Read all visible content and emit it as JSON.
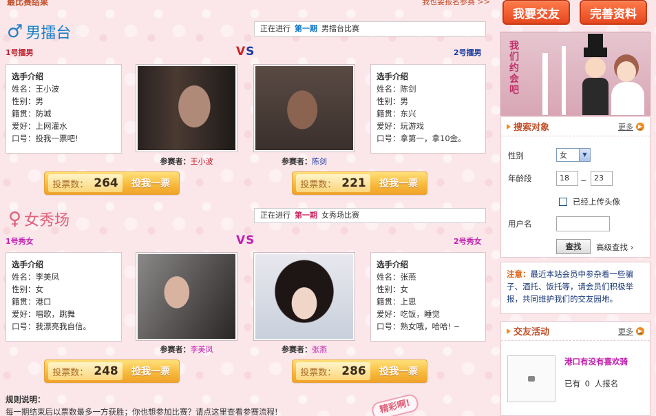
{
  "top": {
    "left_text": "最比赛结果",
    "right_text": "我也要报名参赛 >>"
  },
  "male_section": {
    "symbol": "♂",
    "title": "男擂台",
    "status": {
      "prefix": "正在进行",
      "period": "第一期",
      "suffix": "男擂台比赛"
    },
    "left_slot": "1号擂男",
    "right_slot": "2号擂男",
    "vs": "VS",
    "left": {
      "intro_title": "选手介绍",
      "fields": [
        "姓名：王小波",
        "性别：男",
        "籍贯：防城",
        "爱好：上网灌水",
        "口号：投我一票吧!"
      ],
      "caption_label": "参赛者：",
      "caption_name": "王小波",
      "vote_label": "投票数：",
      "votes": "264",
      "vote_button": "投我一票"
    },
    "right": {
      "intro_title": "选手介绍",
      "fields": [
        "姓名：陈剑",
        "性别：男",
        "籍贯：东兴",
        "爱好：玩游戏",
        "口号：拿第一，拿10金。"
      ],
      "caption_label": "参赛者：",
      "caption_name": "陈剑",
      "vote_label": "投票数：",
      "votes": "221",
      "vote_button": "投我一票"
    }
  },
  "female_section": {
    "symbol": "♀",
    "title": "女秀场",
    "status": {
      "prefix": "正在进行",
      "period": "第一期",
      "suffix": "女秀场比赛"
    },
    "left_slot": "1号秀女",
    "right_slot": "2号秀女",
    "vs": "VS",
    "left": {
      "intro_title": "选手介绍",
      "fields": [
        "姓名：李美凤",
        "性别：女",
        "籍贯：港口",
        "爱好：唱歌，跳舞",
        "口号：我漂亮我自信。"
      ],
      "caption_label": "参赛者：",
      "caption_name": "李美凤",
      "vote_label": "投票数：",
      "votes": "248",
      "vote_button": "投我一票"
    },
    "right": {
      "intro_title": "选手介绍",
      "fields": [
        "姓名：张燕",
        "性别：女",
        "籍贯：上思",
        "爱好：吃饭，睡觉",
        "口号：熟女哦，哈哈! ~"
      ],
      "caption_label": "参赛者：",
      "caption_name": "张燕",
      "vote_label": "投票数：",
      "votes": "286",
      "vote_button": "投我一票"
    }
  },
  "rules": {
    "title": "规则说明：",
    "text": "每一期结束后以票数最多一方获胜；你也想参加比赛？请点这里查看参赛流程!"
  },
  "stamp_text": "精彩啊!",
  "sidebar": {
    "btn_friends": "我要交友",
    "btn_profile": "完善资料",
    "banner_text": "我们约会吧",
    "search": {
      "title": "搜索对象",
      "more": "更多",
      "gender_label": "性别",
      "gender_value": "女",
      "age_label": "年龄段",
      "age_from": "18",
      "age_sep": "~",
      "age_to": "23",
      "photo_check_label": "已经上传头像",
      "username_label": "用户名",
      "username_value": "",
      "search_button": "查找",
      "advanced": "高级查找 ›"
    },
    "notice": {
      "prefix": "注意：",
      "text": "最近本站会员中参杂着一些骗子、酒托、饭托等，请会员们积极举报，共同维护我们的交友园地。"
    },
    "activity": {
      "title": "交友活动",
      "more": "更多",
      "item_title": "港口有没有喜欢骑",
      "item_count_prefix": "已有",
      "item_count": "0",
      "item_count_suffix": "人报名"
    }
  },
  "colors": {
    "male": "#1d80c6",
    "female": "#e0607a",
    "accent": "#f08a20"
  }
}
